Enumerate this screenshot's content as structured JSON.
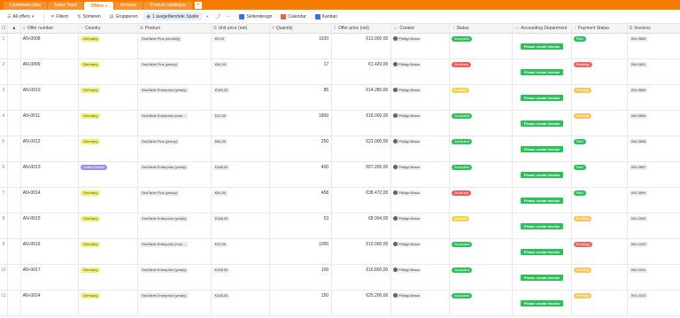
{
  "tabs": [
    {
      "label": "Customers data",
      "active": false
    },
    {
      "label": "Sales Team",
      "active": false
    },
    {
      "label": "Offers",
      "active": true
    },
    {
      "label": "Invoices",
      "active": false
    },
    {
      "label": "Product catalogue",
      "active": false
    }
  ],
  "toolbar": {
    "view": "All offers",
    "filter": "Filtern",
    "sort": "Sortieren",
    "group": "Gruppieren",
    "hidden": "1 ausgeblendete Spalte",
    "pagedesign": "Seitendesign",
    "calendar": "Calendar",
    "kanban": "Kanban"
  },
  "columns": [
    {
      "key": "offer_number",
      "label": "Offer number",
      "icon": "text-icon"
    },
    {
      "key": "country",
      "label": "Country",
      "icon": "select-icon"
    },
    {
      "key": "product",
      "label": "Product",
      "icon": "link-icon"
    },
    {
      "key": "unit_price",
      "label": "Unit price (net)",
      "icon": "link-icon"
    },
    {
      "key": "quantity",
      "label": "Quantity",
      "icon": "number-icon"
    },
    {
      "key": "offer_price",
      "label": "Offer price (net)",
      "icon": "formula-icon"
    },
    {
      "key": "creator",
      "label": "Creator",
      "icon": "creator-icon"
    },
    {
      "key": "status",
      "label": "Status",
      "icon": "select-icon"
    },
    {
      "key": "accounting",
      "label": "Accounting Department",
      "icon": "button-icon"
    },
    {
      "key": "payment",
      "label": "Payment Status",
      "icon": "select-icon"
    },
    {
      "key": "invoices",
      "label": "Invoices",
      "icon": "link-icon"
    }
  ],
  "button_label": "Please create invoice",
  "rows": [
    {
      "n": "1",
      "offer": "AN-0008",
      "country": "Germany",
      "cc": "de",
      "product": "SeaTable Plus (monthly)",
      "unit": "€9,00",
      "qty": "1920",
      "price": "€13.000,00",
      "creator": "Philipp Braun",
      "status": "Accepted",
      "sc": "ok",
      "payment": "Paid",
      "pc": "paid",
      "invoice": "INV-0890"
    },
    {
      "n": "2",
      "offer": "AN-0009",
      "country": "Germany",
      "cc": "de",
      "product": "SeaTable Plus (yearly)",
      "unit": "€84,00",
      "qty": "17",
      "price": "€1.420,00",
      "creator": "Philipp Braun",
      "status": "Declined",
      "sc": "dec",
      "payment": "Running",
      "pc": "run",
      "invoice": "INV-0891"
    },
    {
      "n": "3",
      "offer": "AN-0010",
      "country": "Germany",
      "cc": "de",
      "product": "SeaTable Enterprise (yearly)",
      "unit": "€180,00",
      "qty": "85",
      "price": "€14.280,00",
      "creator": "Philipp Braun",
      "status": "Loaded",
      "sc": "load",
      "payment": "Pending",
      "pc": "pend",
      "invoice": "INV-0894"
    },
    {
      "n": "4",
      "offer": "AN-0011",
      "country": "Germany",
      "cc": "de",
      "product": "SeaTable Enterprise (mon…",
      "unit": "€10,00",
      "qty": "1800",
      "price": "€18.000,00",
      "creator": "Philipp Braun",
      "status": "Accepted",
      "sc": "ok",
      "payment": "Pending",
      "pc": "pend",
      "invoice": "INV-0895"
    },
    {
      "n": "5",
      "offer": "AN-0012",
      "country": "Germany",
      "cc": "de",
      "product": "SeaTable Plus (yearly)",
      "unit": "€84,00",
      "qty": "250",
      "price": "€21.000,00",
      "creator": "Philipp Braun",
      "status": "Accepted",
      "sc": "ok",
      "payment": "Paid",
      "pc": "paid",
      "invoice": "INV-0898"
    },
    {
      "n": "6",
      "offer": "AN-0013",
      "country": "United States",
      "cc": "us",
      "product": "SeaTable Enterprise (yearly)",
      "unit": "€168,00",
      "qty": "400",
      "price": "€67.200,00",
      "creator": "Philipp Braun",
      "status": "Accepted",
      "sc": "ok",
      "payment": "Paid",
      "pc": "paid",
      "invoice": "INV-0897"
    },
    {
      "n": "7",
      "offer": "AN-0014",
      "country": "Germany",
      "cc": "de",
      "product": "SeaTable Plus (yearly)",
      "unit": "€84,00",
      "qty": "458",
      "price": "€38.472,00",
      "creator": "Philipp Braun",
      "status": "Declined",
      "sc": "dec",
      "payment": "Paid",
      "pc": "paid",
      "invoice": "INV-0899"
    },
    {
      "n": "8",
      "offer": "AN-0015",
      "country": "Germany",
      "cc": "de",
      "product": "SeaTable Enterprise (yearly)",
      "unit": "€168,00",
      "qty": "53",
      "price": "€8.904,00",
      "creator": "Philipp Braun",
      "status": "Loaded",
      "sc": "load",
      "payment": "Pending",
      "pc": "pend",
      "invoice": "INV-0900"
    },
    {
      "n": "9",
      "offer": "AN-0016",
      "country": "Germany",
      "cc": "de",
      "product": "SeaTable Enterprise (mon…",
      "unit": "€10,00",
      "qty": "1000",
      "price": "€10.000,00",
      "creator": "Philipp Braun",
      "status": "Accepted",
      "sc": "ok",
      "payment": "Running",
      "pc": "run",
      "invoice": "INV-0100"
    },
    {
      "n": "10",
      "offer": "AN-0017",
      "country": "Germany",
      "cc": "de",
      "product": "SeaTable Enterprise (yearly)",
      "unit": "€168,00",
      "qty": "100",
      "price": "€16.800,00",
      "creator": "Philipp Braun",
      "status": "Accepted",
      "sc": "ok",
      "payment": "Pending",
      "pc": "pend",
      "invoice": "INV-0101"
    },
    {
      "n": "11",
      "offer": "AN-0024",
      "country": "Germany",
      "cc": "de",
      "product": "SeaTable Enterprise (yearly)",
      "unit": "€168,00",
      "qty": "150",
      "price": "€25.200,00",
      "creator": "Philipp Braun",
      "status": "Accepted",
      "sc": "ok",
      "payment": "Pending",
      "pc": "pend",
      "invoice": "INV-0102"
    }
  ]
}
